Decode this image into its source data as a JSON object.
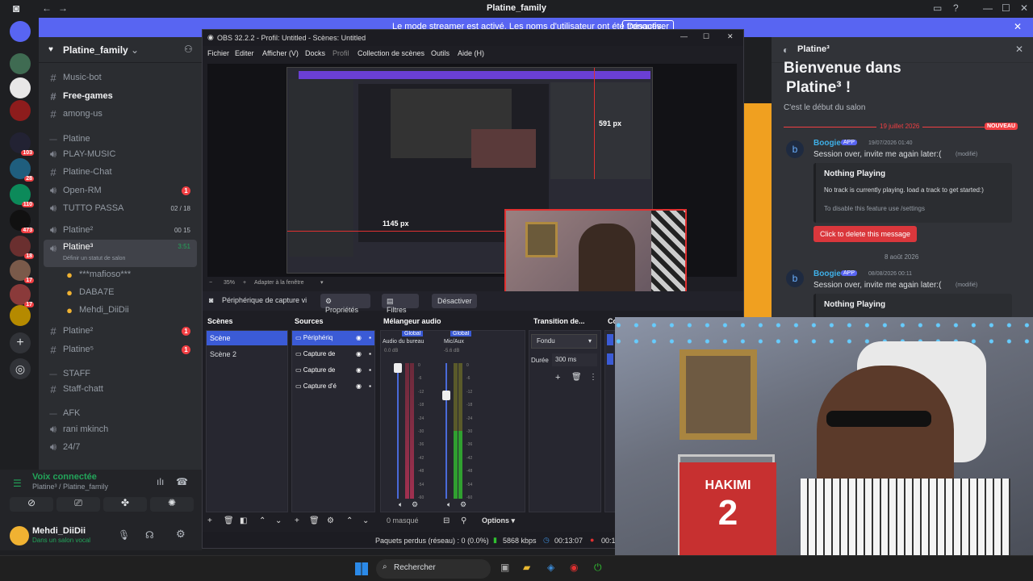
{
  "discord": {
    "window_title": "Platine_family",
    "banner_text": "Le mode streamer est activé. Les noms d'utilisateur ont été tronqués.",
    "banner_button": "Désactiver",
    "server_name": "Platine_family",
    "server_badges": [
      "103",
      "28",
      "110",
      "473",
      "18",
      "17",
      "17"
    ],
    "channels": [
      {
        "label": "Music-bot",
        "icon": "hash",
        "unread": false
      },
      {
        "label": "Free-games",
        "icon": "hash",
        "unread": true
      },
      {
        "label": "among-us",
        "icon": "hash",
        "unread": false
      },
      {
        "label": "Platine",
        "icon": "category",
        "unread": false
      },
      {
        "label": "PLAY-MUSIC",
        "icon": "voice",
        "unread": false
      },
      {
        "label": "Platine-Chat",
        "icon": "hash",
        "unread": false
      },
      {
        "label": "Open-RM",
        "icon": "voice",
        "unread": false,
        "badge": "1"
      },
      {
        "label": "TUTTO PASSA",
        "icon": "voice",
        "unread": false,
        "count": "02 / 18"
      },
      {
        "label": "Platine²",
        "icon": "voice",
        "unread": false,
        "count": "00  15"
      },
      {
        "label": "Platine³",
        "icon": "voice",
        "unread": false,
        "selected": true,
        "time": "3:51",
        "status": "Définir un statut de salon"
      },
      {
        "label": "***mafioso***",
        "icon": "user",
        "unread": false
      },
      {
        "label": "DABA7E",
        "icon": "user",
        "unread": false
      },
      {
        "label": "Mehdi_DiiDii",
        "icon": "user",
        "unread": false
      },
      {
        "label": "Platine²",
        "icon": "hash",
        "unread": false,
        "badge": "1"
      },
      {
        "label": "Platine⁵",
        "icon": "hash",
        "unread": false,
        "badge": "1"
      },
      {
        "label": "STAFF",
        "icon": "category",
        "unread": false
      },
      {
        "label": "Staff-chatt",
        "icon": "hash",
        "unread": false
      },
      {
        "label": "AFK",
        "icon": "category",
        "unread": false
      },
      {
        "label": "rani mkinch",
        "icon": "voice",
        "unread": false
      },
      {
        "label": "24/7",
        "icon": "voice",
        "unread": false
      }
    ],
    "voice_status": "Voix connectée",
    "voice_channel": "Platine³ / Platine_family",
    "user_name": "Mehdi_DiiDii",
    "user_status": "Dans un salon vocal",
    "chat": {
      "channel_name": "Platine³",
      "welcome_line1": "Bienvenue dans",
      "welcome_line2": "Platine³ !",
      "welcome_sub": "C'est le début du salon",
      "date1": "19 juillet 2026",
      "new_label": "NOUVEAU",
      "msg1": {
        "author": "Boogie",
        "app": "APP",
        "time": "19/07/2026 01:40",
        "text": "Session over, invite me again later:(",
        "edited": "(modifié)",
        "embed_title": "Nothing Playing",
        "embed_text": "No track is currently playing. load a track to get started:)",
        "embed_sub": "To disable this feature use /settings",
        "button": "Click to delete this message"
      },
      "date2": "8 août 2026",
      "msg2": {
        "author": "Boogie",
        "app": "APP",
        "time": "08/08/2026 00:11",
        "text": "Session over, invite me again later:(",
        "edited": "(modifié)",
        "embed_title": "Nothing Playing"
      }
    }
  },
  "obs": {
    "title": "OBS 32.2.2 - Profil: Untitled - Scènes: Untitled",
    "menu": [
      "Fichier",
      "Editer",
      "Afficher (V)",
      "Docks",
      "Profil",
      "Collection de scènes",
      "Outils",
      "Aide (H)"
    ],
    "preview_label_w": "1145 px",
    "preview_label_h": "591 px",
    "zoom": "35%",
    "fit_label": "Adapter à la fenêtre",
    "source_toolbar": {
      "name": "Périphérique de capture vi",
      "properties": "Propriétés",
      "filters": "Filtres",
      "deactivate": "Désactiver"
    },
    "docks": {
      "scenes": "Scènes",
      "sources": "Sources",
      "mixer": "Mélangeur audio",
      "transitions": "Transition de...",
      "controls": "Co"
    },
    "scenes": [
      "Scène",
      "Scène 2"
    ],
    "sources": [
      "Périphériq",
      "Capture de",
      "Capture de",
      "Capture d'é"
    ],
    "mixer": {
      "global": "Global",
      "ch1": {
        "name": "Audio du bureau",
        "level": "0.0 dB"
      },
      "ch2": {
        "name": "Mic/Aux",
        "level": "-5.6 dB"
      },
      "ticks": [
        "0",
        "-6",
        "-12",
        "-18",
        "-24",
        "-30",
        "-36",
        "-42",
        "-48",
        "-54",
        "-60"
      ],
      "hidden": "0 masqué",
      "options": "Options"
    },
    "transition": {
      "type": "Fondu",
      "duration_label": "Durée",
      "duration": "300 ms"
    },
    "status": {
      "dropped": "Paquets perdus (réseau) : 0 (0.0%)",
      "bitrate": "5868 kbps",
      "rec_time": "00:13:07",
      "stream_time": "00:15"
    }
  },
  "taskbar": {
    "search": "Rechercher"
  },
  "colors": {
    "discord_bg": "#1e1f22",
    "blurple": "#5865f2",
    "obs_bg": "#1e1e24",
    "red": "#f23f43",
    "green": "#23a55a"
  }
}
